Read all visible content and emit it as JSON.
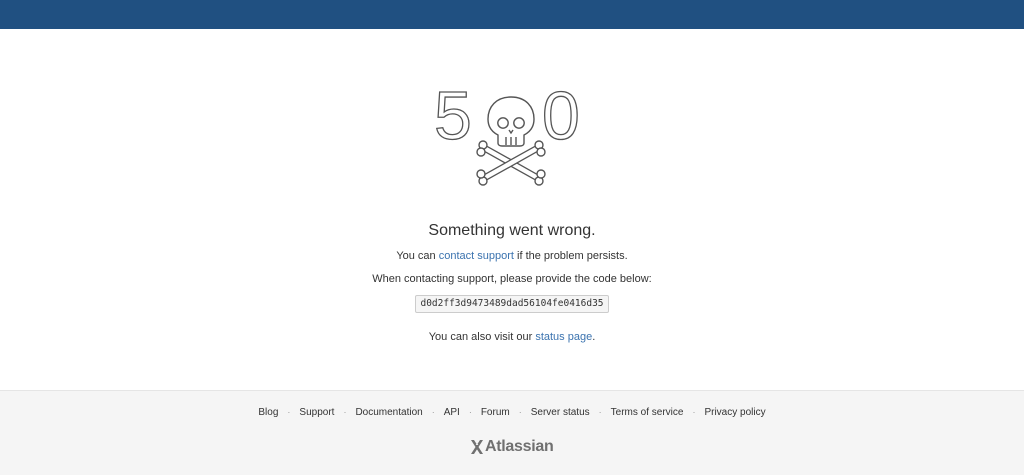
{
  "hero": {
    "digit_left": "5",
    "digit_right": "0"
  },
  "message": {
    "heading": "Something went wrong.",
    "line1_prefix": "You can ",
    "line1_link": "contact support",
    "line1_suffix": " if the problem persists.",
    "line2": "When contacting support, please provide the code below:",
    "error_code": "d0d2ff3d9473489dad56104fe0416d35",
    "line4_prefix": "You can also visit our ",
    "line4_link": "status page",
    "line4_suffix": "."
  },
  "footer": {
    "links": [
      "Blog",
      "Support",
      "Documentation",
      "API",
      "Forum",
      "Server status",
      "Terms of service",
      "Privacy policy"
    ],
    "separator": "·",
    "logo_text": "Atlassian"
  },
  "colors": {
    "topbar": "#205081",
    "link": "#3b73af",
    "footer_bg": "#f5f5f5"
  }
}
